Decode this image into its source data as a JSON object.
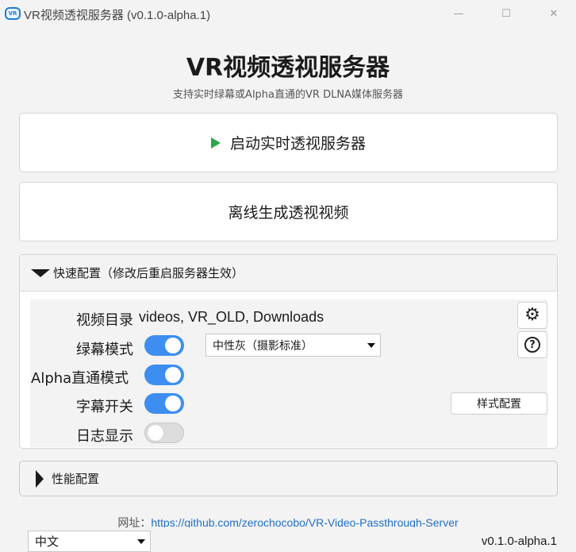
{
  "window": {
    "icon_text": "VR",
    "title": "VR视频透视服务器 (v0.1.0-alpha.1)",
    "minimize": "—",
    "maximize": "☐",
    "close": "✕"
  },
  "header": {
    "title": "VR视频透视服务器",
    "subtitle": "支持实时绿幕或Alpha直通的VR DLNA媒体服务器"
  },
  "actions": {
    "start_label": "启动实时透视服务器",
    "offline_label": "离线生成透视视频"
  },
  "quick_config": {
    "header": "快速配置（修改后重启服务器生效）",
    "video_dir_label": "视频目录",
    "video_dir_value": "videos, VR_OLD, Downloads",
    "green_mode_label": "绿幕模式",
    "green_mode_on": true,
    "green_mode_option": "中性灰（摄影标准）",
    "alpha_label": "Alpha直通模式",
    "alpha_on": true,
    "subtitle_label": "字幕开关",
    "subtitle_on": true,
    "style_button": "样式配置",
    "log_label": "日志显示",
    "log_on": false,
    "help_glyph": "?",
    "gear_glyph": "⚙"
  },
  "perf_config": {
    "header": "性能配置"
  },
  "footer": {
    "url_label": "网址：",
    "url": "https://github.com/zerochocobo/VR-Video-Passthrough-Server",
    "language": "中文",
    "version": "v0.1.0-alpha.1"
  },
  "colors": {
    "accent": "#3d8ef0",
    "play": "#2aa84a",
    "link": "#1f6fc6"
  }
}
